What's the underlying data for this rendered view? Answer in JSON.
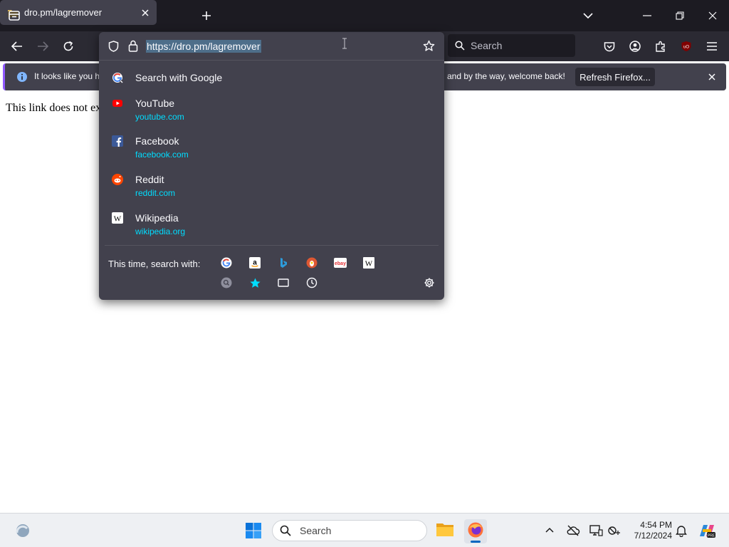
{
  "tab": {
    "title": "dro.pm/lagremover"
  },
  "urlbar": {
    "url": "https://dro.pm/lagremover"
  },
  "search": {
    "placeholder": "Search"
  },
  "notification": {
    "text_left": "It looks like you ha",
    "text_right": "and by the way, welcome back!",
    "button_label": "Refresh Firefox..."
  },
  "page": {
    "text": "This link does not ex"
  },
  "suggestions": [
    {
      "title": "Search with Google",
      "subtitle": "",
      "icon": "google-icon"
    },
    {
      "title": "YouTube",
      "subtitle": "youtube.com",
      "icon": "youtube-icon"
    },
    {
      "title": "Facebook",
      "subtitle": "facebook.com",
      "icon": "facebook-icon"
    },
    {
      "title": "Reddit",
      "subtitle": "reddit.com",
      "icon": "reddit-icon"
    },
    {
      "title": "Wikipedia",
      "subtitle": "wikipedia.org",
      "icon": "wikipedia-icon"
    }
  ],
  "oneoff": {
    "label": "This time, search with:",
    "engines": [
      "google",
      "amazon",
      "bing",
      "duckduckgo",
      "ebay",
      "wikipedia"
    ],
    "modes": [
      "search",
      "bookmarks",
      "tabs",
      "history"
    ]
  },
  "taskbar": {
    "search_placeholder": "Search",
    "time": "4:54 PM",
    "date": "7/12/2024"
  },
  "colors": {
    "tabstrip": "#1c1b22",
    "toolbar": "#2b2a33",
    "popup": "#42414d",
    "accent_cyan": "#00ddff",
    "selection": "#4e6e8a"
  }
}
